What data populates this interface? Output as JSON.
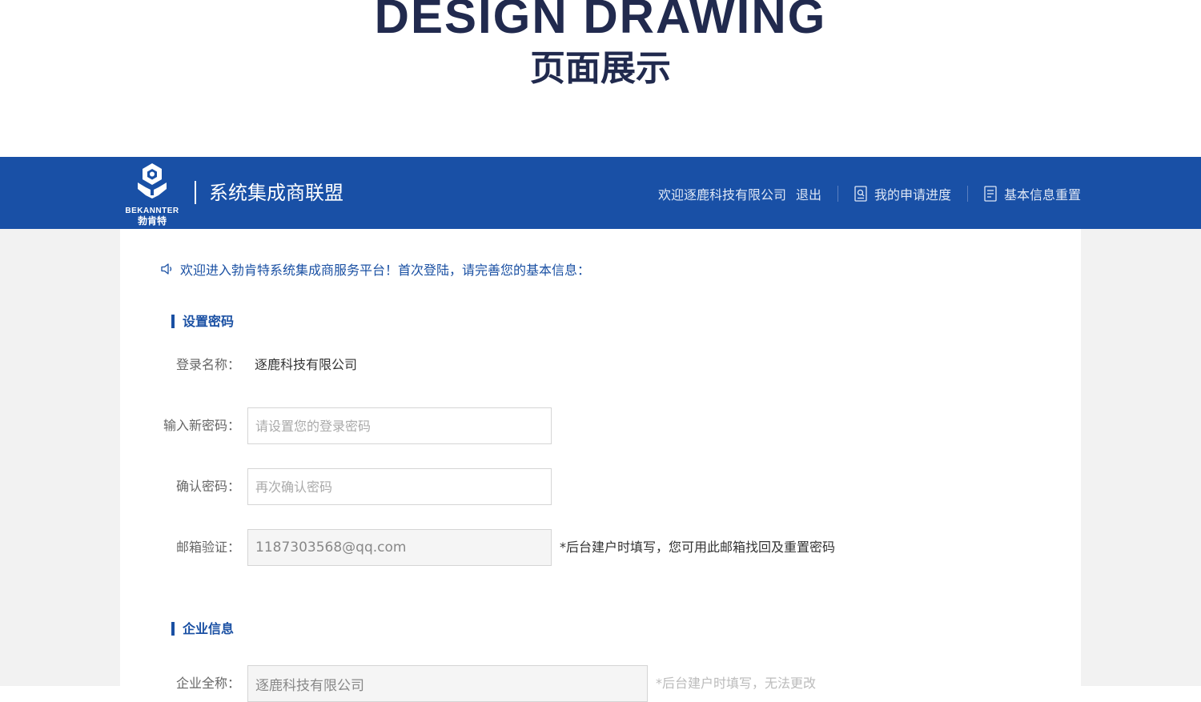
{
  "hero": {
    "title": "DESIGN DRAWING",
    "subtitle": "页面展示"
  },
  "header": {
    "logo_en": "BEKANNTER",
    "logo_cn": "勃肯特",
    "brand": "系统集成商联盟",
    "welcome": "欢迎逐鹿科技有限公司",
    "logout": "退出",
    "progress": "我的申请进度",
    "reset": "基本信息重置",
    "accent": "#1950a6"
  },
  "notice": "欢迎进入勃肯特系统集成商服务平台！首次登陆，请完善您的基本信息：",
  "password_section": {
    "title": "设置密码",
    "login_name_label": "登录名称：",
    "login_name_value": "逐鹿科技有限公司",
    "new_password_label": "输入新密码：",
    "new_password_placeholder": "请设置您的登录密码",
    "confirm_label": "确认密码：",
    "confirm_placeholder": "再次确认密码",
    "email_label": "邮箱验证：",
    "email_value": "1187303568@qq.com",
    "email_hint": "*后台建户时填写，您可用此邮箱找回及重置密码"
  },
  "company_section": {
    "title": "企业信息",
    "fullname_label": "企业全称：",
    "fullname_value": "逐鹿科技有限公司",
    "fullname_hint": "*后台建户时填写，无法更改"
  }
}
